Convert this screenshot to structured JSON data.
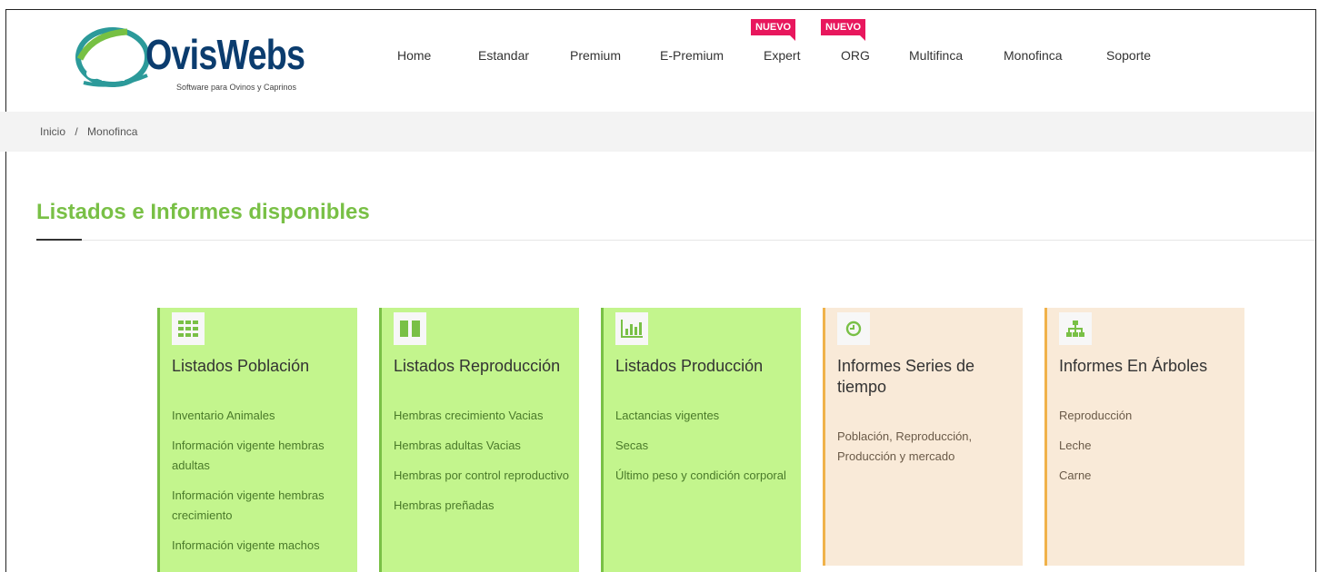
{
  "brand": {
    "name": "OvisWebs",
    "tagline": "Software para Ovinos y Caprinos"
  },
  "nav": {
    "items": [
      {
        "label": "Home"
      },
      {
        "label": "Estandar"
      },
      {
        "label": "Premium"
      },
      {
        "label": "E-Premium"
      },
      {
        "label": "Expert",
        "badge": "NUEVO"
      },
      {
        "label": "ORG",
        "badge": "NUEVO"
      },
      {
        "label": "Multifinca"
      },
      {
        "label": "Monofinca"
      },
      {
        "label": "Soporte"
      }
    ]
  },
  "breadcrumb": {
    "home": "Inicio",
    "separator": "/",
    "current": "Monofinca"
  },
  "section": {
    "title": "Listados e Informes disponibles"
  },
  "cards": [
    {
      "title": "Listados Población",
      "icon": "grid-icon",
      "links": [
        "Inventario Animales",
        "Información vigente hembras adultas",
        "Información vigente hembras crecimiento",
        "Información vigente machos"
      ]
    },
    {
      "title": "Listados Reproducción",
      "icon": "columns-icon",
      "links": [
        "Hembras crecimiento Vacias",
        "Hembras adultas Vacias",
        "Hembras por control reproductivo",
        "Hembras preñadas"
      ]
    },
    {
      "title": "Listados Producción",
      "icon": "bar-chart-icon",
      "links": [
        "Lactancias vigentes",
        "Secas",
        "Último peso y condición corporal"
      ]
    },
    {
      "title": "Informes Series de tiempo",
      "icon": "clock-icon",
      "links": [
        "Población, Reproducción, Producción y mercado"
      ]
    },
    {
      "title": "Informes En Árboles",
      "icon": "sitemap-icon",
      "links": [
        "Reproducción",
        "Leche",
        "Carne"
      ]
    }
  ],
  "colors": {
    "accent_green": "#79c046",
    "card_green": "#c3f58d",
    "card_peach": "#f9ead8",
    "accent_orange": "#f0b24a",
    "badge_pink": "#e8175d",
    "brand_navy": "#0b3c6e"
  }
}
